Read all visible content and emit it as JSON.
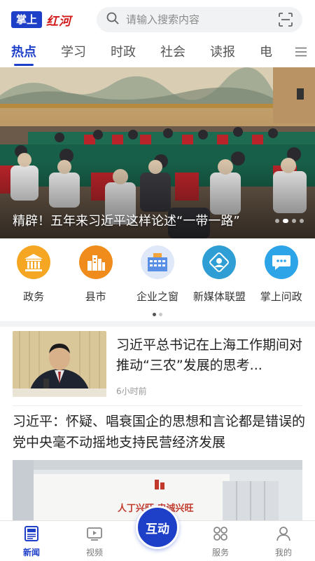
{
  "header": {
    "logo_box": "掌上",
    "logo_script": "红河",
    "search_placeholder": "请输入搜索内容"
  },
  "tabs": [
    {
      "label": "热点",
      "active": true
    },
    {
      "label": "学习"
    },
    {
      "label": "时政"
    },
    {
      "label": "社会"
    },
    {
      "label": "读报"
    },
    {
      "label": "电"
    }
  ],
  "banner": {
    "title": "精辟！五年来习近平这样论述“一带一路”",
    "slide_count": 4,
    "active_slide": 1
  },
  "grid": [
    {
      "label": "政务",
      "icon": "government-building-icon",
      "color": "#f5a623"
    },
    {
      "label": "县市",
      "icon": "city-skyline-icon",
      "color": "#f08c1c"
    },
    {
      "label": "企业之窗",
      "icon": "company-building-icon",
      "color": "#5a8fe6"
    },
    {
      "label": "新媒体联盟",
      "icon": "media-alliance-icon",
      "color": "#2f9ed4"
    },
    {
      "label": "掌上问政",
      "icon": "chat-bubble-icon",
      "color": "#2ea4e8"
    }
  ],
  "news": [
    {
      "title": "习近平总书记在上海工作期间对推动“三农”发展的思考...",
      "time": "6小时前"
    },
    {
      "title": "习近平：怀疑、唱衰国企的思想和言论都是错误的 党中央毫不动摇地支持民营经济发展",
      "image_text": "人丁兴旺 忠诚兴旺"
    }
  ],
  "bottom_nav": {
    "news": "新闻",
    "video": "视频",
    "interact": "互动",
    "service": "服务",
    "mine": "我的"
  },
  "colors": {
    "brand_blue": "#1e3fc8",
    "logo_red": "#d11919"
  }
}
